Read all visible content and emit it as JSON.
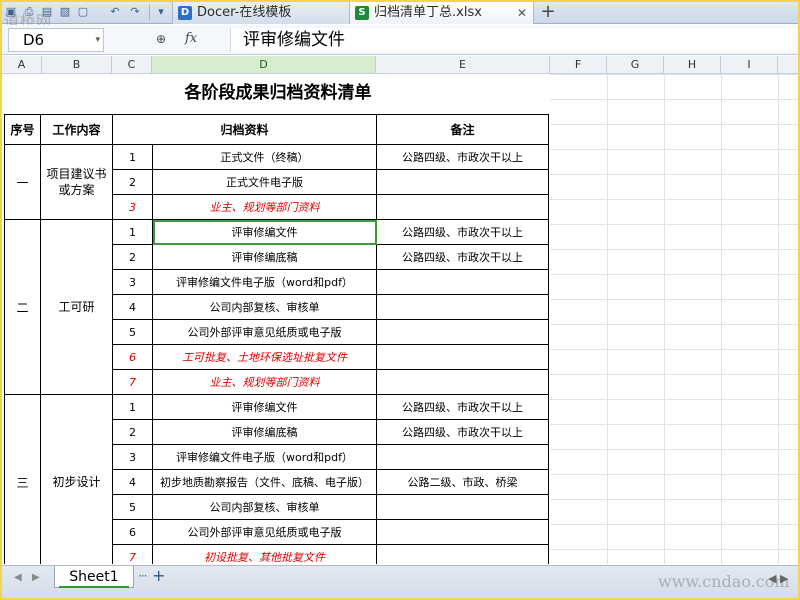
{
  "quick_access_icons": [
    "save-icon",
    "print-icon",
    "print-preview-icon",
    "undo-icon",
    "redo-icon",
    "dropdown-icon"
  ],
  "tabs": [
    {
      "label": "Docer-在线模板",
      "icon": "docer-icon"
    },
    {
      "label": "归档清单丁总.xlsx",
      "icon": "spreadsheet-icon"
    }
  ],
  "watermark_top": "道桥网",
  "formula_bar": {
    "cell_ref": "D6",
    "fx_label": "fx",
    "content": "评审修编文件"
  },
  "columns": [
    "A",
    "B",
    "C",
    "D",
    "E",
    "F",
    "G",
    "H",
    "I"
  ],
  "selected_column": "D",
  "sheet": {
    "title": "各阶段成果归档资料清单",
    "headers": {
      "seq": "序号",
      "work": "工作内容",
      "docs": "归档资料",
      "remark": "备注"
    },
    "groups": [
      {
        "seq": "一",
        "work": "项目建议书或方案",
        "rows": [
          {
            "no": "1",
            "doc": "正式文件（终稿）",
            "remark": "公路四级、市政次干以上",
            "red": false
          },
          {
            "no": "2",
            "doc": "正式文件电子版",
            "remark": "",
            "red": false
          },
          {
            "no": "3",
            "doc": "业主、规划等部门资料",
            "remark": "",
            "red": true
          }
        ]
      },
      {
        "seq": "二",
        "work": "工可研",
        "rows": [
          {
            "no": "1",
            "doc": "评审修编文件",
            "remark": "公路四级、市政次干以上",
            "red": false
          },
          {
            "no": "2",
            "doc": "评审修编底稿",
            "remark": "公路四级、市政次干以上",
            "red": false
          },
          {
            "no": "3",
            "doc": "评审修编文件电子版（word和pdf）",
            "remark": "",
            "red": false
          },
          {
            "no": "4",
            "doc": "公司内部复核、审核单",
            "remark": "",
            "red": false
          },
          {
            "no": "5",
            "doc": "公司外部评审意见纸质或电子版",
            "remark": "",
            "red": false
          },
          {
            "no": "6",
            "doc": "工可批复、土地环保选址批复文件",
            "remark": "",
            "red": true
          },
          {
            "no": "7",
            "doc": "业主、规划等部门资料",
            "remark": "",
            "red": true
          }
        ]
      },
      {
        "seq": "三",
        "work": "初步设计",
        "rows": [
          {
            "no": "1",
            "doc": "评审修编文件",
            "remark": "公路四级、市政次干以上",
            "red": false
          },
          {
            "no": "2",
            "doc": "评审修编底稿",
            "remark": "公路四级、市政次干以上",
            "red": false
          },
          {
            "no": "3",
            "doc": "评审修编文件电子版（word和pdf）",
            "remark": "",
            "red": false
          },
          {
            "no": "4",
            "doc": "初步地质勘察报告（文件、底稿、电子版）",
            "remark": "公路二级、市政、桥梁",
            "red": false
          },
          {
            "no": "5",
            "doc": "公司内部复核、审核单",
            "remark": "",
            "red": false
          },
          {
            "no": "6",
            "doc": "公司外部评审意见纸质或电子版",
            "remark": "",
            "red": false
          },
          {
            "no": "7",
            "doc": "初设批复、其他批复文件",
            "remark": "",
            "red": true
          }
        ]
      }
    ]
  },
  "bottom": {
    "sheet_tab": "Sheet1",
    "more": "···",
    "add": "+",
    "watermark": "www.cndao.com",
    "scroll_mark": "◀ ▶"
  },
  "colors": {
    "active_cell": "#3d9a3d",
    "red_text": "#d00000",
    "frame": "#f1d64d"
  }
}
